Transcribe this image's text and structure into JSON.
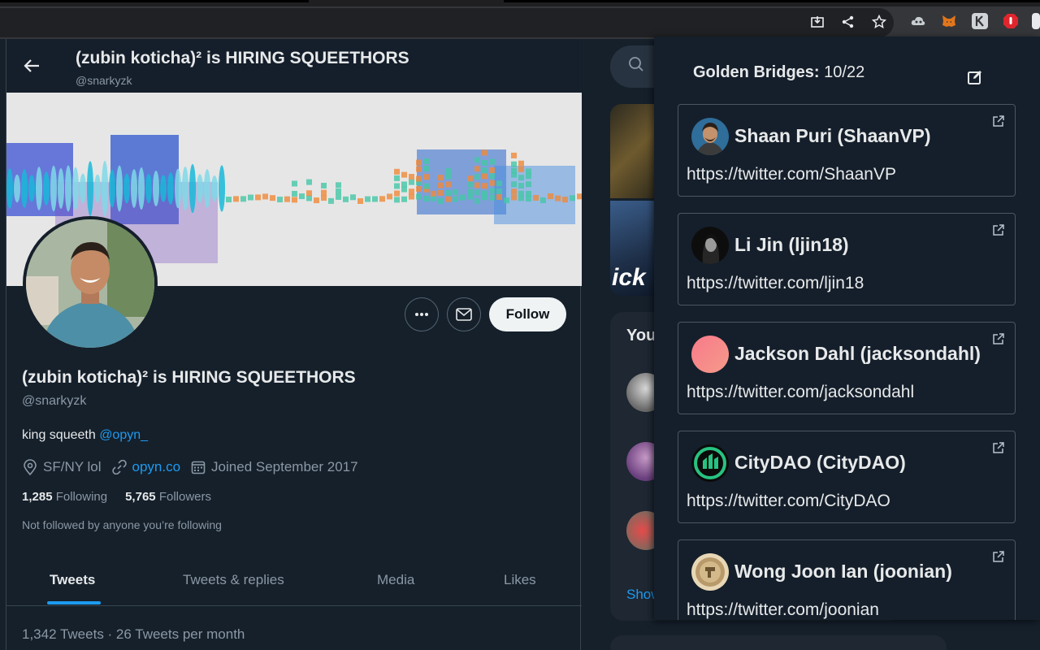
{
  "browser": {
    "toolbar_icons": [
      "install-app-icon",
      "share-icon",
      "bookmark-star-icon"
    ],
    "extensions": [
      "cloud-extension-icon",
      "metamask-fox-icon",
      "k-extension-icon",
      "stop-hand-extension-icon"
    ]
  },
  "profile": {
    "header_name": "(zubin koticha)² is HIRING SQUEETHORS",
    "header_handle": "@snarkyzk",
    "display_name": "(zubin koticha)² is HIRING SQUEETHORS",
    "handle": "@snarkyzk",
    "bio_text": "king squeeth ",
    "bio_mention": "@opyn_",
    "location": "SF/NY lol",
    "website": "opyn.co",
    "joined": "Joined September 2017",
    "following_count": "1,285",
    "following_label": "Following",
    "followers_count": "5,765",
    "followers_label": "Followers",
    "not_followed": "Not followed by anyone you’re following",
    "follow_label": "Follow",
    "tabs": [
      "Tweets",
      "Tweets & replies",
      "Media",
      "Likes"
    ],
    "active_tab": "Tweets",
    "tweet_count": "1,342 Tweets · 26 Tweets per month"
  },
  "sidebar": {
    "wtf_title": "You",
    "show_more": "Show",
    "media_text": "ick"
  },
  "popup": {
    "title_label": "Golden Bridges:",
    "title_count": "10/22",
    "cards": [
      {
        "name": "Shaan Puri (ShaanVP)",
        "url": "https://twitter.com/ShaanVP"
      },
      {
        "name": "Li Jin (ljin18)",
        "url": "https://twitter.com/ljin18"
      },
      {
        "name": "Jackson Dahl (jacksondahl)",
        "url": "https://twitter.com/jacksondahl"
      },
      {
        "name": "CityDAO (CityDAO)",
        "url": "https://twitter.com/CityDAO"
      },
      {
        "name": "Wong Joon Ian (joonian)",
        "url": "https://twitter.com/joonian"
      }
    ]
  },
  "colors": {
    "background": "#15202b",
    "accent_blue": "#1d9bf0",
    "follow_button": "#eff3f4",
    "popup_background": "#151f2b",
    "card_border": "#4a5663"
  }
}
